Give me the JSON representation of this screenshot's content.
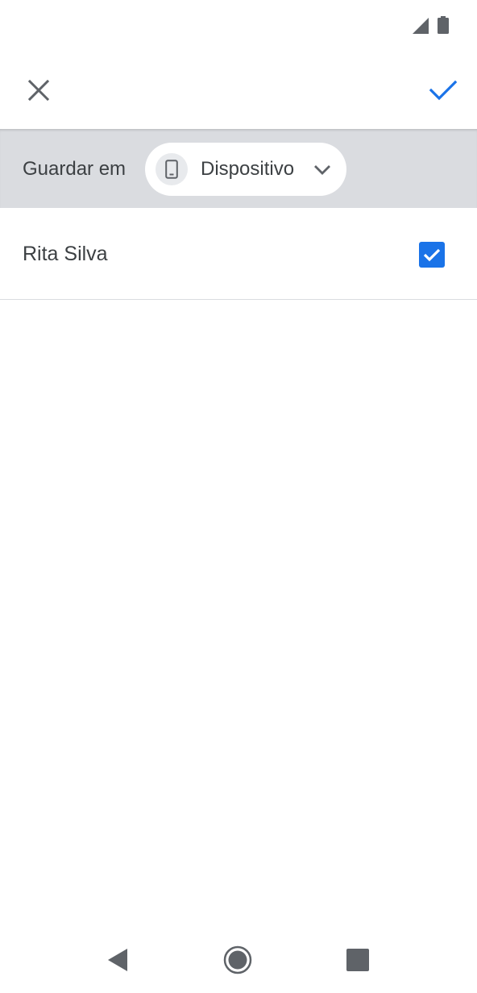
{
  "colors": {
    "accent": "#1a73e8",
    "save_bar_bg": "#dadce0",
    "icon_gray": "#5f6368",
    "text": "#3c4043"
  },
  "status_bar": {
    "icons": [
      "signal-icon",
      "battery-icon"
    ]
  },
  "app_bar": {
    "close_icon": "close-icon",
    "confirm_icon": "check-icon"
  },
  "save_location": {
    "label": "Guardar em",
    "chip_icon": "phone-icon",
    "selected": "Dispositivo",
    "dropdown_icon": "chevron-down-icon"
  },
  "contact": {
    "name": "Rita Silva",
    "checked": true
  },
  "nav_bar": {
    "icons": [
      "back-icon",
      "home-icon",
      "recents-icon"
    ]
  }
}
